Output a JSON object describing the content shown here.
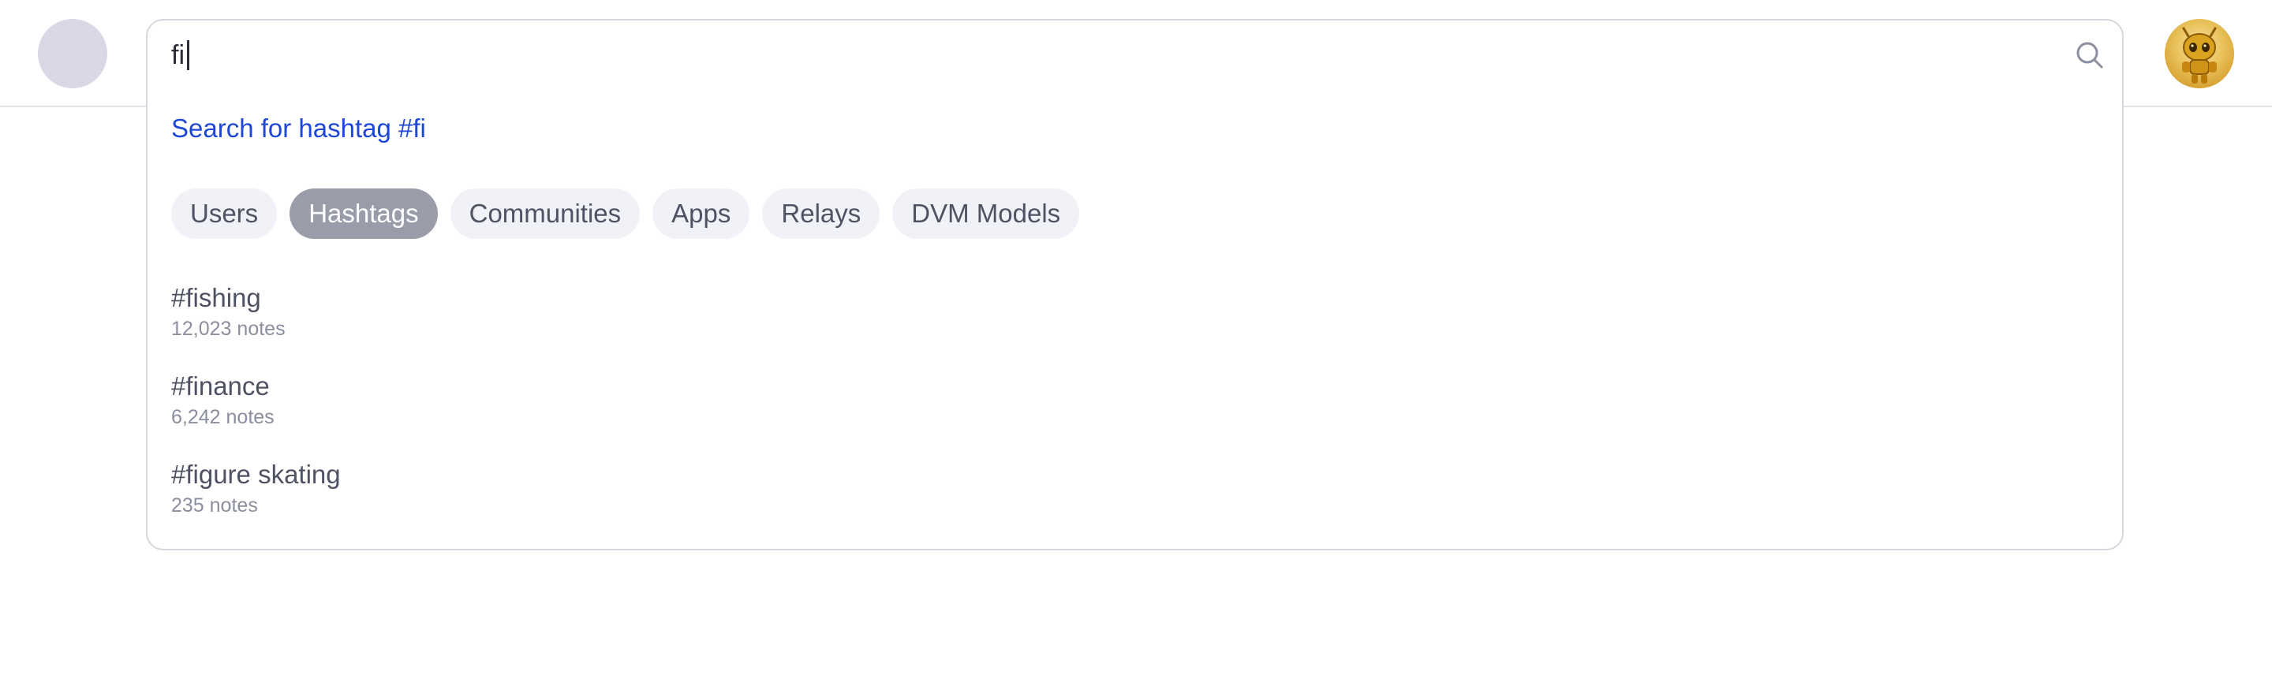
{
  "header": {
    "logo_icon": "app-logo-icon",
    "avatar_icon": "golden-robot-avatar-icon"
  },
  "search": {
    "query": "fi",
    "icon": "search-icon",
    "hashtag_suggestion": "Search for hashtag #fi"
  },
  "tabs": [
    {
      "label": "Users",
      "active": false
    },
    {
      "label": "Hashtags",
      "active": true
    },
    {
      "label": "Communities",
      "active": false
    },
    {
      "label": "Apps",
      "active": false
    },
    {
      "label": "Relays",
      "active": false
    },
    {
      "label": "DVM Models",
      "active": false
    }
  ],
  "results": [
    {
      "title": "#fishing",
      "count": "12,023 notes"
    },
    {
      "title": "#finance",
      "count": "6,242 notes"
    },
    {
      "title": "#figure skating",
      "count": "235 notes"
    }
  ],
  "colors": {
    "link": "#1f47d6",
    "active_tab": "#9a9caa",
    "tab_bg": "#f1f2f7"
  }
}
